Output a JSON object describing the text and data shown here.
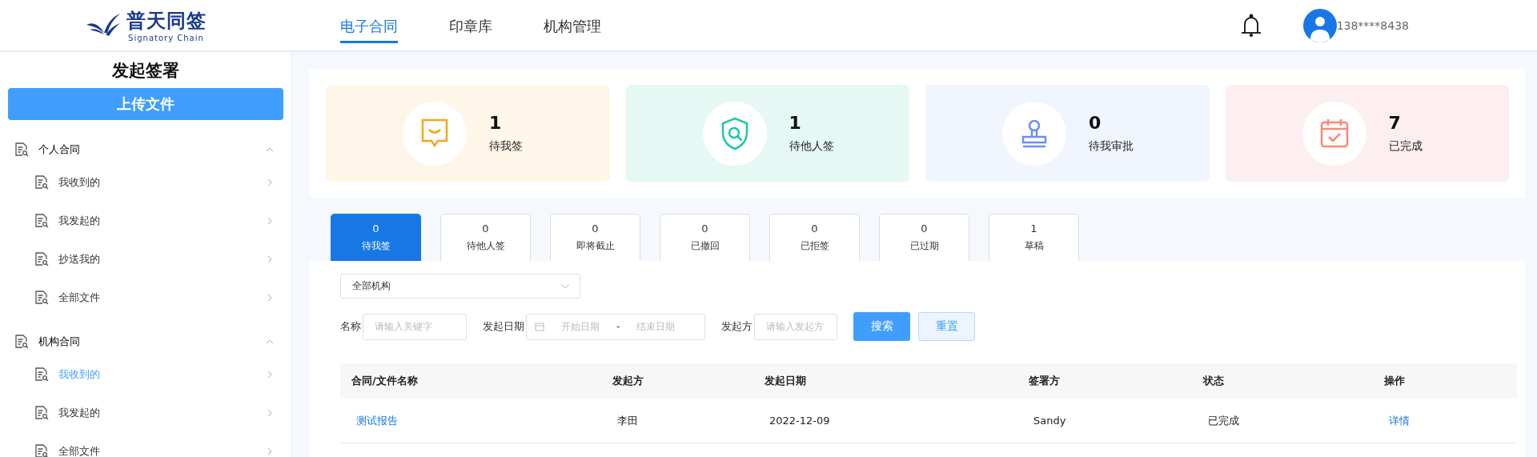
{
  "logo": {
    "name": "普天同签",
    "tagline": "Signatory Chain"
  },
  "nav": [
    {
      "label": "电子合同",
      "selected": true
    },
    {
      "label": "印章库",
      "selected": false
    },
    {
      "label": "机构管理",
      "selected": false
    }
  ],
  "user": {
    "phone": "138****8438"
  },
  "sidebar": {
    "title": "发起签署",
    "upload_button": "上传文件",
    "groups": [
      {
        "label": "个人合同",
        "expanded": true,
        "children": [
          {
            "label": "我收到的",
            "selected": false
          },
          {
            "label": "我发起的",
            "selected": false
          },
          {
            "label": "抄送我的",
            "selected": false
          },
          {
            "label": "全部文件",
            "selected": false
          }
        ]
      },
      {
        "label": "机构合同",
        "expanded": true,
        "children": [
          {
            "label": "我收到的",
            "selected": true
          },
          {
            "label": "我发起的",
            "selected": false
          },
          {
            "label": "全部文件",
            "selected": false
          }
        ]
      }
    ]
  },
  "stats": [
    {
      "kind": "sign",
      "count": "1",
      "label": "待我签"
    },
    {
      "kind": "others",
      "count": "1",
      "label": "待他人签"
    },
    {
      "kind": "approve",
      "count": "0",
      "label": "待我审批"
    },
    {
      "kind": "done",
      "count": "7",
      "label": "已完成"
    }
  ],
  "tabs": [
    {
      "count": "0",
      "label": "待我签",
      "selected": true
    },
    {
      "count": "0",
      "label": "待他人签",
      "selected": false
    },
    {
      "count": "0",
      "label": "即将截止",
      "selected": false
    },
    {
      "count": "0",
      "label": "已撤回",
      "selected": false
    },
    {
      "count": "0",
      "label": "已拒签",
      "selected": false
    },
    {
      "count": "0",
      "label": "已过期",
      "selected": false
    },
    {
      "count": "1",
      "label": "草稿",
      "selected": false
    }
  ],
  "org_select": {
    "value": "全部机构"
  },
  "filters": {
    "name_label": "名称",
    "name_placeholder": "请输入关键字",
    "date_label": "发起日期",
    "start_placeholder": "开始日期",
    "separator": "-",
    "end_placeholder": "结束日期",
    "initiator_label": "发起方",
    "initiator_placeholder": "请输入发起方",
    "search_button": "搜索",
    "reset_button": "重置"
  },
  "table": {
    "columns": [
      "合同/文件名称",
      "发起方",
      "发起日期",
      "签署方",
      "状态",
      "操作"
    ],
    "rows": [
      {
        "cells": [
          "测试报告",
          "李田",
          "2022-12-09",
          "Sandy",
          "已完成",
          "详情"
        ]
      }
    ]
  }
}
